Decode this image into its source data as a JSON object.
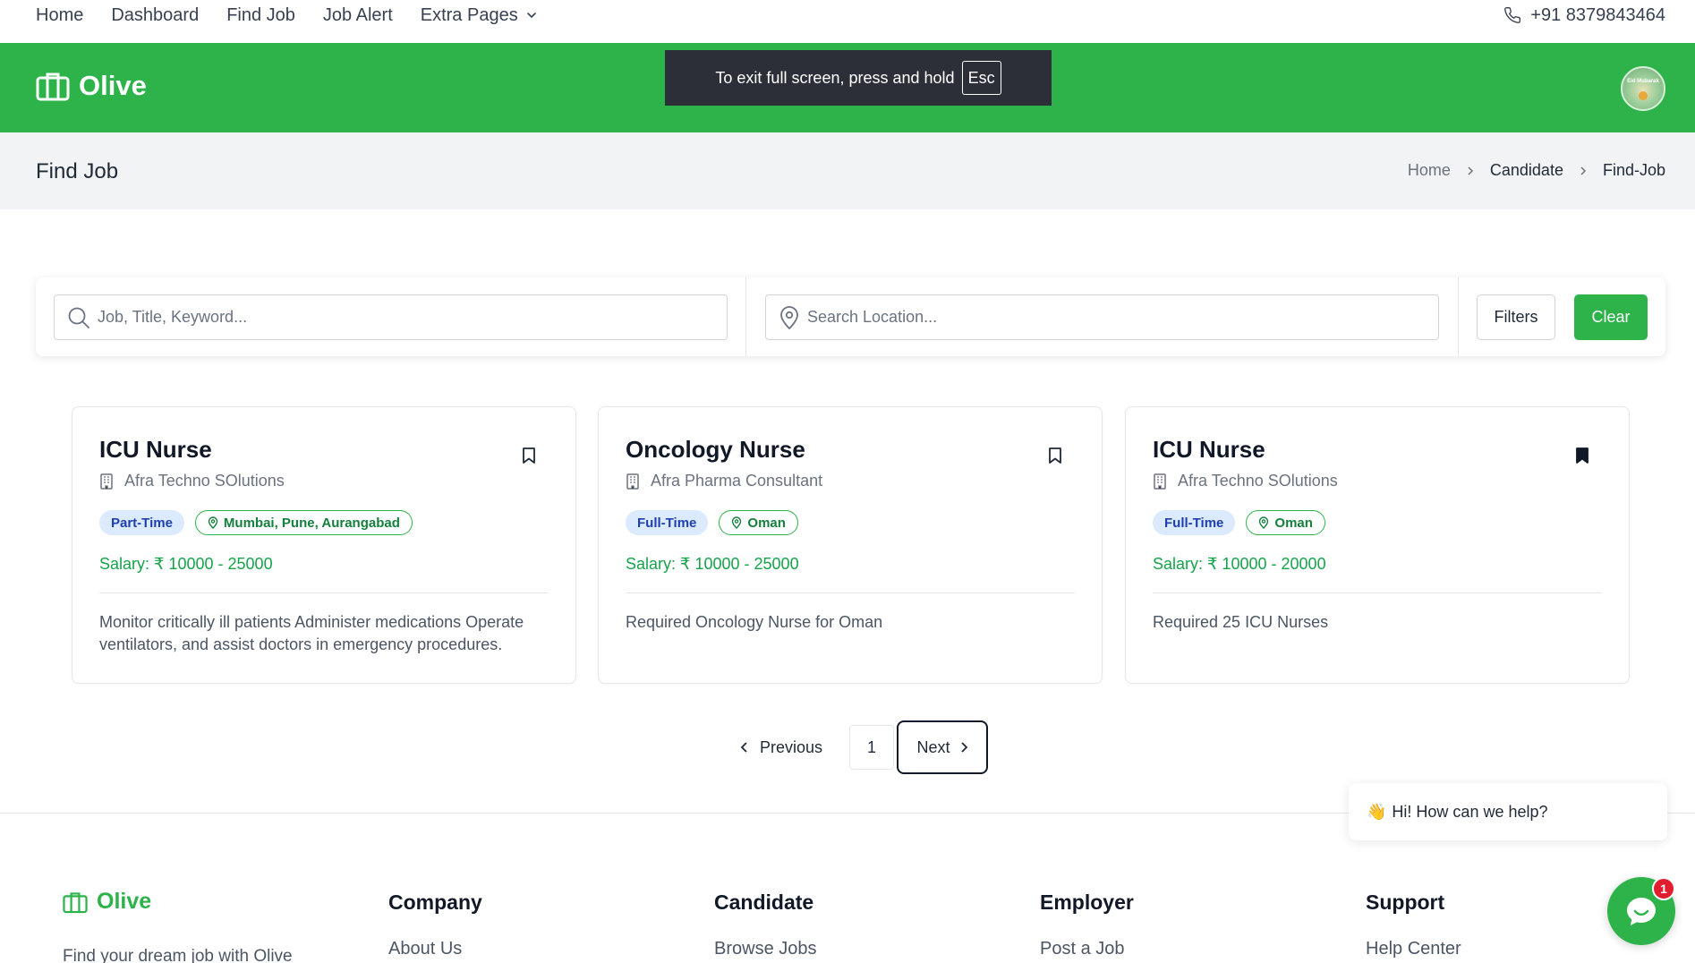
{
  "topnav": {
    "links": [
      "Home",
      "Dashboard",
      "Find Job",
      "Job Alert",
      "Extra Pages"
    ],
    "phone": "+91 8379843464"
  },
  "header": {
    "brand": "Olive",
    "avatar_text": "Eid Mubarak"
  },
  "fullscreen_toast": {
    "text": "To exit full screen, press and hold",
    "key": "Esc"
  },
  "page": {
    "title": "Find Job",
    "breadcrumb": [
      "Home",
      "Candidate",
      "Find-Job"
    ]
  },
  "search": {
    "keyword_placeholder": "Job, Title, Keyword...",
    "location_placeholder": "Search Location...",
    "filters_label": "Filters",
    "clear_label": "Clear"
  },
  "jobs": [
    {
      "title": "ICU Nurse",
      "company": "Afra Techno SOlutions",
      "type": "Part-Time",
      "location": "Mumbai, Pune, Aurangabad",
      "salary": "Salary: ₹ 10000 - 25000",
      "description": "Monitor critically ill patients Administer medications Operate ventilators, and assist doctors in emergency procedures.",
      "bookmarked": false
    },
    {
      "title": "Oncology Nurse",
      "company": "Afra Pharma Consultant",
      "type": "Full-Time",
      "location": "Oman",
      "salary": "Salary: ₹ 10000 - 25000",
      "description": "Required Oncology Nurse for Oman",
      "bookmarked": false
    },
    {
      "title": "ICU Nurse",
      "company": "Afra Techno SOlutions",
      "type": "Full-Time",
      "location": "Oman",
      "salary": "Salary: ₹ 10000 - 20000",
      "description": "Required 25 ICU Nurses",
      "bookmarked": true
    }
  ],
  "pagination": {
    "previous_label": "Previous",
    "current_page": "1",
    "next_label": "Next"
  },
  "chat": {
    "wave_icon": "👋",
    "greeting": "Hi! How can we help?",
    "unread_count": "1"
  },
  "footer": {
    "brand": "Olive",
    "tagline": "Find your dream job with Olive",
    "columns": [
      {
        "heading": "Company",
        "first_link": "About Us"
      },
      {
        "heading": "Candidate",
        "first_link": "Browse Jobs"
      },
      {
        "heading": "Employer",
        "first_link": "Post a Job"
      },
      {
        "heading": "Support",
        "first_link": "Help Center"
      }
    ]
  },
  "colors": {
    "brand_green": "#2db34a",
    "type_badge_bg": "#dbeafe",
    "type_badge_text": "#1e40af",
    "salary_green": "#16a34a",
    "chat_badge_red": "#e11d2e"
  }
}
